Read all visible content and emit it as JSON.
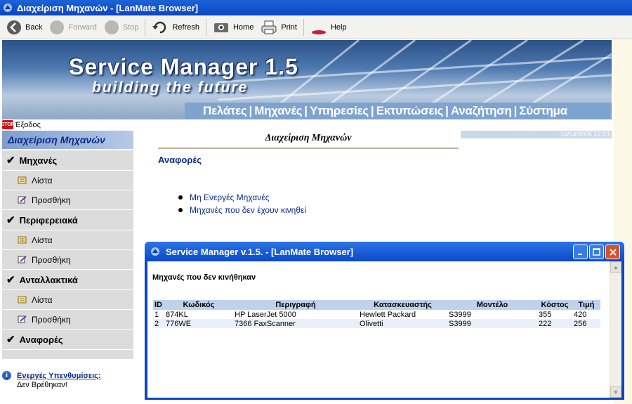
{
  "window": {
    "title": "Διαχείριση Μηχανών - [LanMate Browser]"
  },
  "toolbar": {
    "back": "Back",
    "forward": "Forward",
    "stop": "Stop",
    "refresh": "Refresh",
    "home": "Home",
    "print": "Print",
    "help": "Help"
  },
  "banner": {
    "title": "Service Manager 1.5",
    "subtitle": "building the future",
    "nav": [
      "Πελάτες",
      "Μηχανές",
      "Υπηρεσίες",
      "Εκτυπώσεις",
      "Αναζήτηση",
      "Σύστημα"
    ]
  },
  "exit": {
    "label": "Έξοδος",
    "icon_text": "STOP"
  },
  "date": "10/14/2005 12:23",
  "sidebar": {
    "header": "Διαχείριση Μηχανών",
    "sections": [
      {
        "label": "Μηχανές",
        "items": [
          "Λίστα",
          "Προσθήκη"
        ]
      },
      {
        "label": "Περιφερειακά",
        "items": [
          "Λίστα",
          "Προσθήκη"
        ]
      },
      {
        "label": "Ανταλλακτικά",
        "items": [
          "Λίστα",
          "Προσθήκη"
        ]
      },
      {
        "label": "Αναφορές",
        "items": []
      }
    ]
  },
  "reminders": {
    "title": "Ενεργές Υπενθυμίσεις:",
    "value": "Δεν Βρέθηκαν!"
  },
  "main": {
    "heading": "Διαχείριση Μηχανών",
    "reports_title": "Αναφορές",
    "links": [
      "Μη Ενεργές Μηχανές",
      "Μηχανές που δεν έχουν κινηθεί"
    ]
  },
  "popup": {
    "title": "Service Manager v.1.5. - [LanMate Browser]",
    "heading": "Μηχανές που δεν κινήθηκαν",
    "columns": [
      "ID",
      "Κωδικός",
      "Περιγραφή",
      "Κατασκευαστής",
      "Μοντέλο",
      "Κόστος",
      "Τιμή"
    ],
    "rows": [
      [
        "1",
        "874KL",
        "HP LaserJet 5000",
        "Hewlett Packard",
        "S3999",
        "355",
        "420"
      ],
      [
        "2",
        "776WE",
        "7366 FaxScanner",
        "Olivetti",
        "S3999",
        "222",
        "256"
      ]
    ]
  },
  "colors": {
    "titlebar": "#0a46c3",
    "sidebar_bg": "#dcdcdc",
    "link": "#0b2a86",
    "table_header": "#bed2ec"
  }
}
